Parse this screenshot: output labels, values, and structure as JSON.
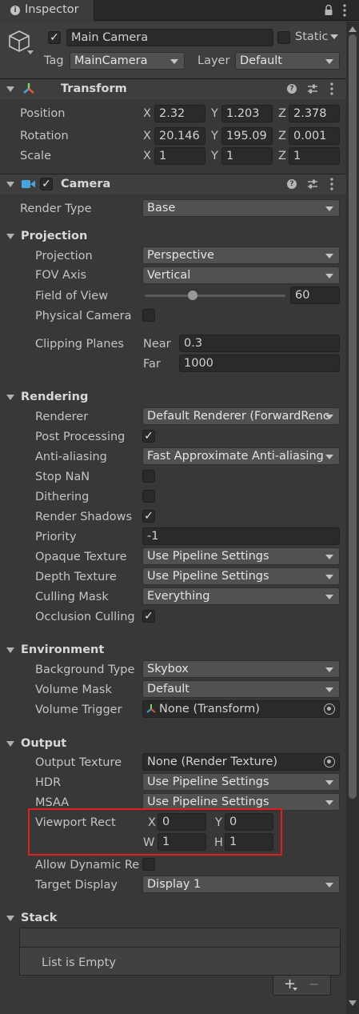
{
  "tab": {
    "icon": "info-icon",
    "title": "Inspector"
  },
  "header": {
    "object_name": "Main Camera",
    "active": true,
    "static_label": "Static",
    "tag_label": "Tag",
    "tag_value": "MainCamera",
    "layer_label": "Layer",
    "layer_value": "Default"
  },
  "transform": {
    "title": "Transform",
    "rows": [
      {
        "label": "Position",
        "x": "2.32",
        "y": "1.203",
        "z": "2.378"
      },
      {
        "label": "Rotation",
        "x": "20.146",
        "y": "195.09",
        "z": "0.001"
      },
      {
        "label": "Scale",
        "x": "1",
        "y": "1",
        "z": "1"
      }
    ],
    "axes": {
      "x": "X",
      "y": "Y",
      "z": "Z"
    }
  },
  "camera": {
    "title": "Camera",
    "enabled": true,
    "render_type_label": "Render Type",
    "render_type_value": "Base"
  },
  "projection": {
    "title": "Projection",
    "projection_label": "Projection",
    "projection_value": "Perspective",
    "fov_axis_label": "FOV Axis",
    "fov_axis_value": "Vertical",
    "fov_label": "Field of View",
    "fov_value": "60",
    "fov_slider_fraction": 0.34,
    "physical_label": "Physical Camera",
    "physical_checked": false,
    "clipping_label": "Clipping Planes",
    "near_label": "Near",
    "near_value": "0.3",
    "far_label": "Far",
    "far_value": "1000"
  },
  "rendering": {
    "title": "Rendering",
    "renderer_label": "Renderer",
    "renderer_value": "Default Renderer (ForwardRenc",
    "post_label": "Post Processing",
    "post_checked": true,
    "aa_label": "Anti-aliasing",
    "aa_value": "Fast Approximate Anti-aliasing",
    "stopnan_label": "Stop NaN",
    "stopnan_checked": false,
    "dither_label": "Dithering",
    "dither_checked": false,
    "shadows_label": "Render Shadows",
    "shadows_checked": true,
    "priority_label": "Priority",
    "priority_value": "-1",
    "opaque_label": "Opaque Texture",
    "opaque_value": "Use Pipeline Settings",
    "depth_label": "Depth Texture",
    "depth_value": "Use Pipeline Settings",
    "culling_label": "Culling Mask",
    "culling_value": "Everything",
    "occlusion_label": "Occlusion Culling",
    "occlusion_checked": true
  },
  "environment": {
    "title": "Environment",
    "bg_label": "Background Type",
    "bg_value": "Skybox",
    "vmask_label": "Volume Mask",
    "vmask_value": "Default",
    "vtrigger_label": "Volume Trigger",
    "vtrigger_value": "None (Transform)"
  },
  "output": {
    "title": "Output",
    "texture_label": "Output Texture",
    "texture_value": "None (Render Texture)",
    "hdr_label": "HDR",
    "hdr_value": "Use Pipeline Settings",
    "msaa_label": "MSAA",
    "msaa_value": "Use Pipeline Settings",
    "viewport_label": "Viewport Rect",
    "vp": {
      "x_label": "X",
      "x": "0",
      "y_label": "Y",
      "y": "0",
      "w_label": "W",
      "w": "1",
      "h_label": "H",
      "h": "1"
    },
    "dynamic_label": "Allow Dynamic Re",
    "dynamic_checked": false,
    "display_label": "Target Display",
    "display_value": "Display 1"
  },
  "stack": {
    "title": "Stack",
    "empty_text": "List is Empty",
    "add_label": "+",
    "remove_label": "−"
  },
  "colors": {
    "highlight": "#e02020",
    "accent_camera": "#4aa3df"
  }
}
